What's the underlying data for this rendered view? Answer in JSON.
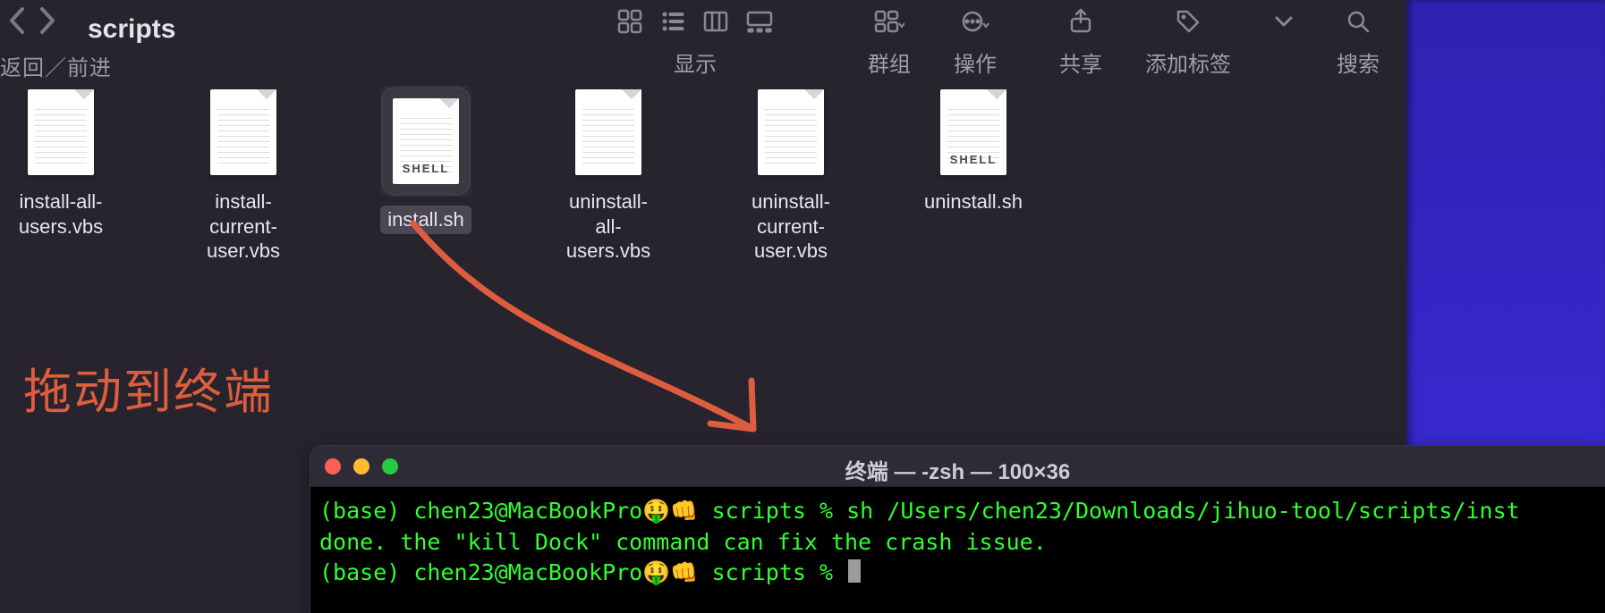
{
  "finder": {
    "folder_title": "scripts",
    "nav_caption": "返回／前进",
    "toolbar": {
      "display_caption": "显示",
      "group_caption": "群组",
      "action_caption": "操作",
      "share_caption": "共享",
      "tag_caption": "添加标签",
      "search_caption": "搜索"
    },
    "files": [
      {
        "name": "install-all-\nusers.vbs",
        "type": "plain",
        "selected": false
      },
      {
        "name": "install-current-\nuser.vbs",
        "type": "plain",
        "selected": false
      },
      {
        "name": "install.sh",
        "type": "shell",
        "selected": true
      },
      {
        "name": "uninstall-all-\nusers.vbs",
        "type": "plain",
        "selected": false
      },
      {
        "name": "uninstall-current-\nuser.vbs",
        "type": "plain",
        "selected": false
      },
      {
        "name": "uninstall.sh",
        "type": "shell",
        "selected": false
      }
    ]
  },
  "annotation": {
    "text": "拖动到终端",
    "arrow_color": "#dd5d3e"
  },
  "terminal": {
    "title": "终端 — -zsh — 100×36",
    "prompt_prefix": "(base) chen23@MacBookPro",
    "prompt_emoji": "🤑👊",
    "prompt_dir": "scripts",
    "prompt_symbol": "%",
    "line1_cmd": "sh /Users/chen23/Downloads/jihuo-tool/scripts/inst",
    "line2": "done. the \"kill Dock\" command can fix the crash issue.",
    "line3_cmd": ""
  }
}
